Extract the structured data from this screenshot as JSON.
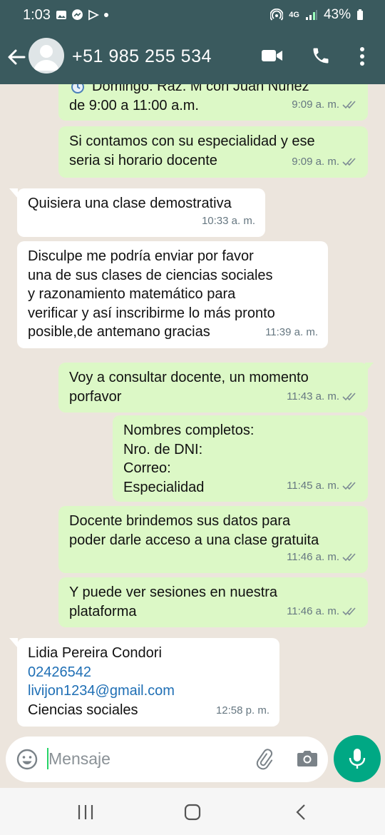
{
  "status_bar": {
    "time": "1:03",
    "network": "4G",
    "battery": "43%"
  },
  "header": {
    "contact": "+51 985 255 534"
  },
  "messages": [
    {
      "dir": "out",
      "lines": [
        "Domingo: Raz. M con Juan Nuñez",
        "de 9:00 a 11:00 a.m."
      ],
      "time": "9:09 a. m."
    },
    {
      "dir": "out",
      "lines": [
        "Si contamos con su especialidad y ese",
        "seria si horario docente"
      ],
      "time": "9:09 a. m."
    },
    {
      "dir": "in",
      "lines": [
        "Quisiera una clase demostrativa"
      ],
      "time": "10:33 a. m."
    },
    {
      "dir": "in",
      "lines": [
        "Disculpe me podría enviar por favor",
        "una de sus clases de ciencias sociales",
        "y razonamiento matemático para",
        "verificar y así inscribirme lo más pronto",
        "posible,de antemano gracias"
      ],
      "time": "11:39 a. m."
    },
    {
      "dir": "out",
      "lines": [
        "Voy a consultar docente, un momento",
        "porfavor"
      ],
      "time": "11:43 a. m."
    },
    {
      "dir": "out",
      "lines": [
        "Nombres completos:",
        "Nro. de DNI:",
        "Correo:",
        "Especialidad"
      ],
      "time": "11:45 a. m."
    },
    {
      "dir": "out",
      "lines": [
        "Docente brindemos sus datos para",
        "poder darle acceso a una clase gratuita"
      ],
      "time": "11:46 a. m."
    },
    {
      "dir": "out",
      "lines": [
        "Y puede ver sesiones en nuestra",
        "plataforma"
      ],
      "time": "11:46 a. m."
    },
    {
      "dir": "in",
      "lines": [
        "Lidia Pereira Condori",
        "02426542",
        "livijon1234@gmail.com",
        "Ciencias sociales"
      ],
      "time": "12:58 p. m."
    }
  ],
  "composer": {
    "placeholder": "Mensaje"
  },
  "colors": {
    "header": "#3a5a5e",
    "outgoing": "#dcf8c6",
    "incoming": "#ffffff",
    "background": "#ece5dd",
    "mic": "#00a884",
    "link": "#1f6fb5"
  },
  "icons": [
    "arrow-left-icon",
    "avatar-icon",
    "video-icon",
    "phone-icon",
    "more-vert-icon",
    "emoji-icon",
    "paperclip-icon",
    "camera-icon",
    "mic-icon",
    "double-check-icon",
    "alarm-clock-icon"
  ]
}
